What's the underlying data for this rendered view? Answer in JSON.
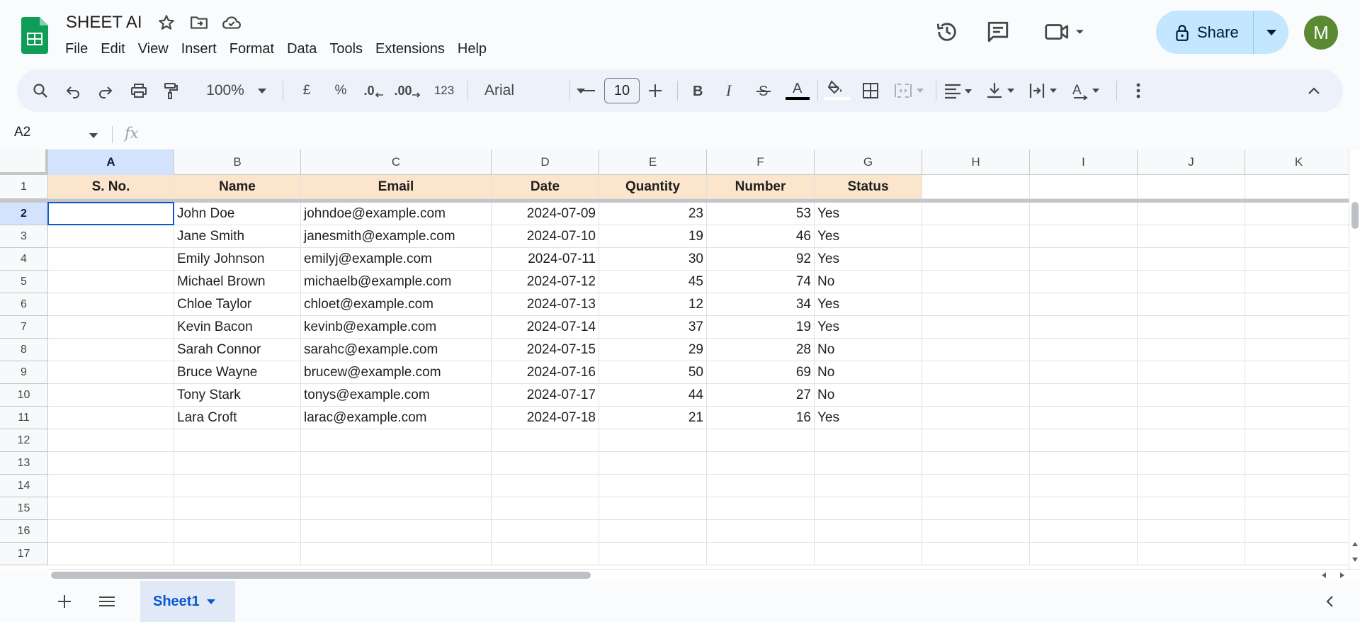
{
  "app": {
    "title": "SHEET AI",
    "menu": [
      "File",
      "Edit",
      "View",
      "Insert",
      "Format",
      "Data",
      "Tools",
      "Extensions",
      "Help"
    ],
    "share_label": "Share",
    "avatar_initial": "M",
    "accent": "#0b57d0"
  },
  "toolbar": {
    "zoom": "100%",
    "currency": "£",
    "percent": "%",
    "dec_decrease": ".0",
    "dec_increase": ".00",
    "number_format": "123",
    "font": "Arial",
    "font_size": "10"
  },
  "formula": {
    "namebox": "A2",
    "fx": "fx",
    "value": ""
  },
  "sheet": {
    "columns": [
      "A",
      "B",
      "C",
      "D",
      "E",
      "F",
      "G",
      "H",
      "I",
      "J",
      "K"
    ],
    "rows": [
      "1",
      "2",
      "3",
      "4",
      "5",
      "6",
      "7",
      "8",
      "9",
      "10",
      "11",
      "12",
      "13",
      "14",
      "15",
      "16",
      "17"
    ],
    "header_row": [
      "S. No.",
      "Name",
      "Email",
      "Date",
      "Quantity",
      "Number",
      "Status"
    ],
    "data": [
      [
        "",
        "John Doe",
        "johndoe@example.com",
        "2024-07-09",
        "23",
        "53",
        "Yes"
      ],
      [
        "",
        "Jane Smith",
        "janesmith@example.com",
        "2024-07-10",
        "19",
        "46",
        "Yes"
      ],
      [
        "",
        "Emily Johnson",
        "emilyj@example.com",
        "2024-07-11",
        "30",
        "92",
        "Yes"
      ],
      [
        "",
        "Michael Brown",
        "michaelb@example.com",
        "2024-07-12",
        "45",
        "74",
        "No"
      ],
      [
        "",
        "Chloe Taylor",
        "chloet@example.com",
        "2024-07-13",
        "12",
        "34",
        "Yes"
      ],
      [
        "",
        "Kevin Bacon",
        "kevinb@example.com",
        "2024-07-14",
        "37",
        "19",
        "Yes"
      ],
      [
        "",
        "Sarah Connor",
        "sarahc@example.com",
        "2024-07-15",
        "29",
        "28",
        "No"
      ],
      [
        "",
        "Bruce Wayne",
        "brucew@example.com",
        "2024-07-16",
        "50",
        "69",
        "No"
      ],
      [
        "",
        "Tony Stark",
        "tonys@example.com",
        "2024-07-17",
        "44",
        "27",
        "No"
      ],
      [
        "",
        "Lara Croft",
        "larac@example.com",
        "2024-07-18",
        "21",
        "16",
        "Yes"
      ]
    ],
    "selected_cell": "A2",
    "header_fill": "#fce5cd"
  },
  "tabs": {
    "sheet_name": "Sheet1"
  }
}
